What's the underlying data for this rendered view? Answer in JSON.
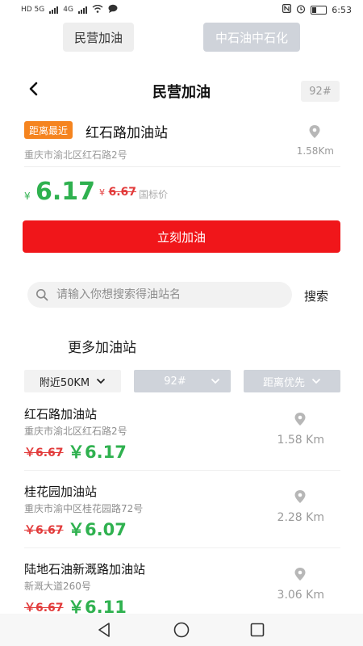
{
  "status_bar": {
    "left_network_1": "HD 5G",
    "left_network_2": "4G",
    "time": "6:53"
  },
  "top_tabs": {
    "private": "民营加油",
    "sinopec": "中石油中石化"
  },
  "header": {
    "title": "民营加油",
    "fuel_type": "92#"
  },
  "nearest": {
    "tag": "距离最近",
    "name": "红石路加油站",
    "address": "重庆市渝北区红石路2号",
    "distance": "1.58Km",
    "yen_symbol": "¥",
    "price": "6.17",
    "old_price_symbol": "¥",
    "old_price": "6.67",
    "old_price_label": "国标价",
    "button_label": "立刻加油"
  },
  "search": {
    "placeholder": "请输入你想搜索得油站名",
    "button_label": "搜索"
  },
  "more_title": "更多加油站",
  "filters": {
    "distance": "附近50KM",
    "fuel": "92#",
    "sort": "距离优先"
  },
  "stations": [
    {
      "name": "红石路加油站",
      "address": "重庆市渝北区红石路2号",
      "old_price": "￥6.67",
      "new_price": "￥6.17",
      "distance": "1.58 Km"
    },
    {
      "name": "桂花园加油站",
      "address": "重庆市渝中区桂花园路72号",
      "old_price": "￥6.67",
      "new_price": "￥6.07",
      "distance": "2.28 Km"
    },
    {
      "name": "陆地石油新溉路加油站",
      "address": "新溉大道260号",
      "old_price": "￥6.67",
      "new_price": "￥6.11",
      "distance": "3.06 Km"
    }
  ],
  "colors": {
    "accent_red": "#f0161a",
    "price_green": "#2fb14f",
    "tag_orange": "#f5841f",
    "disabled_grey": "#cfd3da"
  }
}
